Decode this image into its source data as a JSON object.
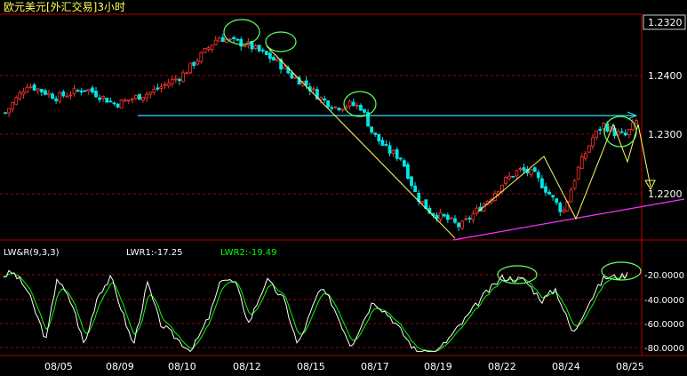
{
  "chart_data": [
    {
      "type": "candlestick",
      "title": "欧元美元[外汇交易]3小时",
      "current_price": "1.2320",
      "price_axis": {
        "ticks": [
          "1.2400",
          "1.2300",
          "1.2200"
        ],
        "ylim": [
          1.2115,
          1.2505
        ]
      },
      "date_axis": [
        "08/05",
        "08/09",
        "08/10",
        "08/12",
        "08/15",
        "08/17",
        "08/19",
        "08/22",
        "08/24",
        "08/25"
      ],
      "close_path": [
        [
          0,
          1.2335
        ],
        [
          6,
          1.2385
        ],
        [
          14,
          1.2362
        ],
        [
          22,
          1.2378
        ],
        [
          30,
          1.235
        ],
        [
          40,
          1.2372
        ],
        [
          48,
          1.24
        ],
        [
          54,
          1.244
        ],
        [
          58,
          1.2468
        ],
        [
          62,
          1.246
        ],
        [
          66,
          1.2455
        ],
        [
          70,
          1.244
        ],
        [
          74,
          1.2425
        ],
        [
          78,
          1.24
        ],
        [
          82,
          1.2385
        ],
        [
          86,
          1.236
        ],
        [
          90,
          1.2345
        ],
        [
          94,
          1.235
        ],
        [
          97,
          1.2345
        ],
        [
          100,
          1.23
        ],
        [
          104,
          1.227
        ],
        [
          108,
          1.2255
        ],
        [
          112,
          1.219
        ],
        [
          116,
          1.216
        ],
        [
          120,
          1.215
        ],
        [
          124,
          1.2135
        ],
        [
          128,
          1.216
        ],
        [
          132,
          1.2185
        ],
        [
          136,
          1.2215
        ],
        [
          140,
          1.2235
        ],
        [
          144,
          1.2228
        ],
        [
          148,
          1.2195
        ],
        [
          152,
          1.216
        ],
        [
          156,
          1.2235
        ],
        [
          160,
          1.229
        ],
        [
          163,
          1.2315
        ],
        [
          166,
          1.23
        ],
        [
          169,
          1.2295
        ],
        [
          172,
          1.232
        ]
      ],
      "candle_count": 175
    },
    {
      "type": "line",
      "title": "LW&R(9,3,3)",
      "series": [
        {
          "name": "LWR1",
          "last_label": "LWR1:-17.25",
          "color": "#ffffff"
        },
        {
          "name": "LWR2",
          "last_label": "LWR2:-19.49",
          "color": "#00ff00"
        }
      ],
      "y_ticks": [
        "-20.0000",
        "-40.0000",
        "-60.0000",
        "-80.0000"
      ],
      "ylim": [
        -87,
        -5
      ]
    }
  ],
  "colors": {
    "up": "#ff3232",
    "down": "#00e5e5",
    "annotation_line": "#ffff66",
    "support_line": "#ff33ff",
    "resistance_line": "#33e0ff",
    "highlight_circle": "#66ff66"
  }
}
